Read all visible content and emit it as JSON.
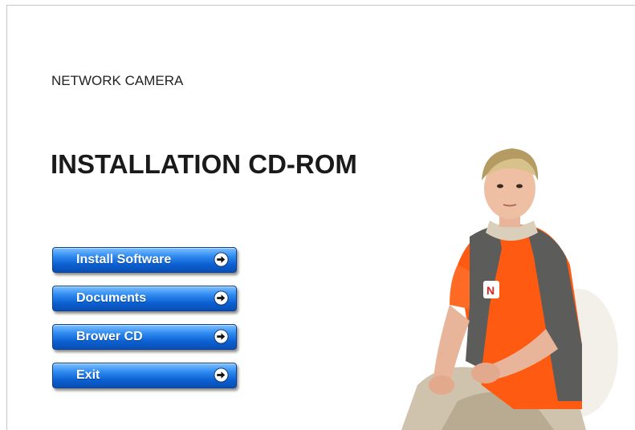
{
  "header": {
    "subtitle": "NETWORK CAMERA",
    "title": "INSTALLATION CD-ROM"
  },
  "menu": {
    "items": [
      {
        "label": "Install Software",
        "icon": "arrow-right-circle-icon"
      },
      {
        "label": "Documents",
        "icon": "arrow-right-circle-icon"
      },
      {
        "label": "Brower CD",
        "icon": "arrow-right-circle-icon"
      },
      {
        "label": "Exit",
        "icon": "arrow-right-circle-icon"
      }
    ]
  },
  "colors": {
    "button_blue": "#0b5fd1",
    "button_highlight": "#7ec1ff",
    "text": "#1a1a1a",
    "shirt_orange": "#ff5a12",
    "vest_gray": "#5c5c5a"
  },
  "photo": {
    "description_icon": "boy-portrait-image"
  }
}
